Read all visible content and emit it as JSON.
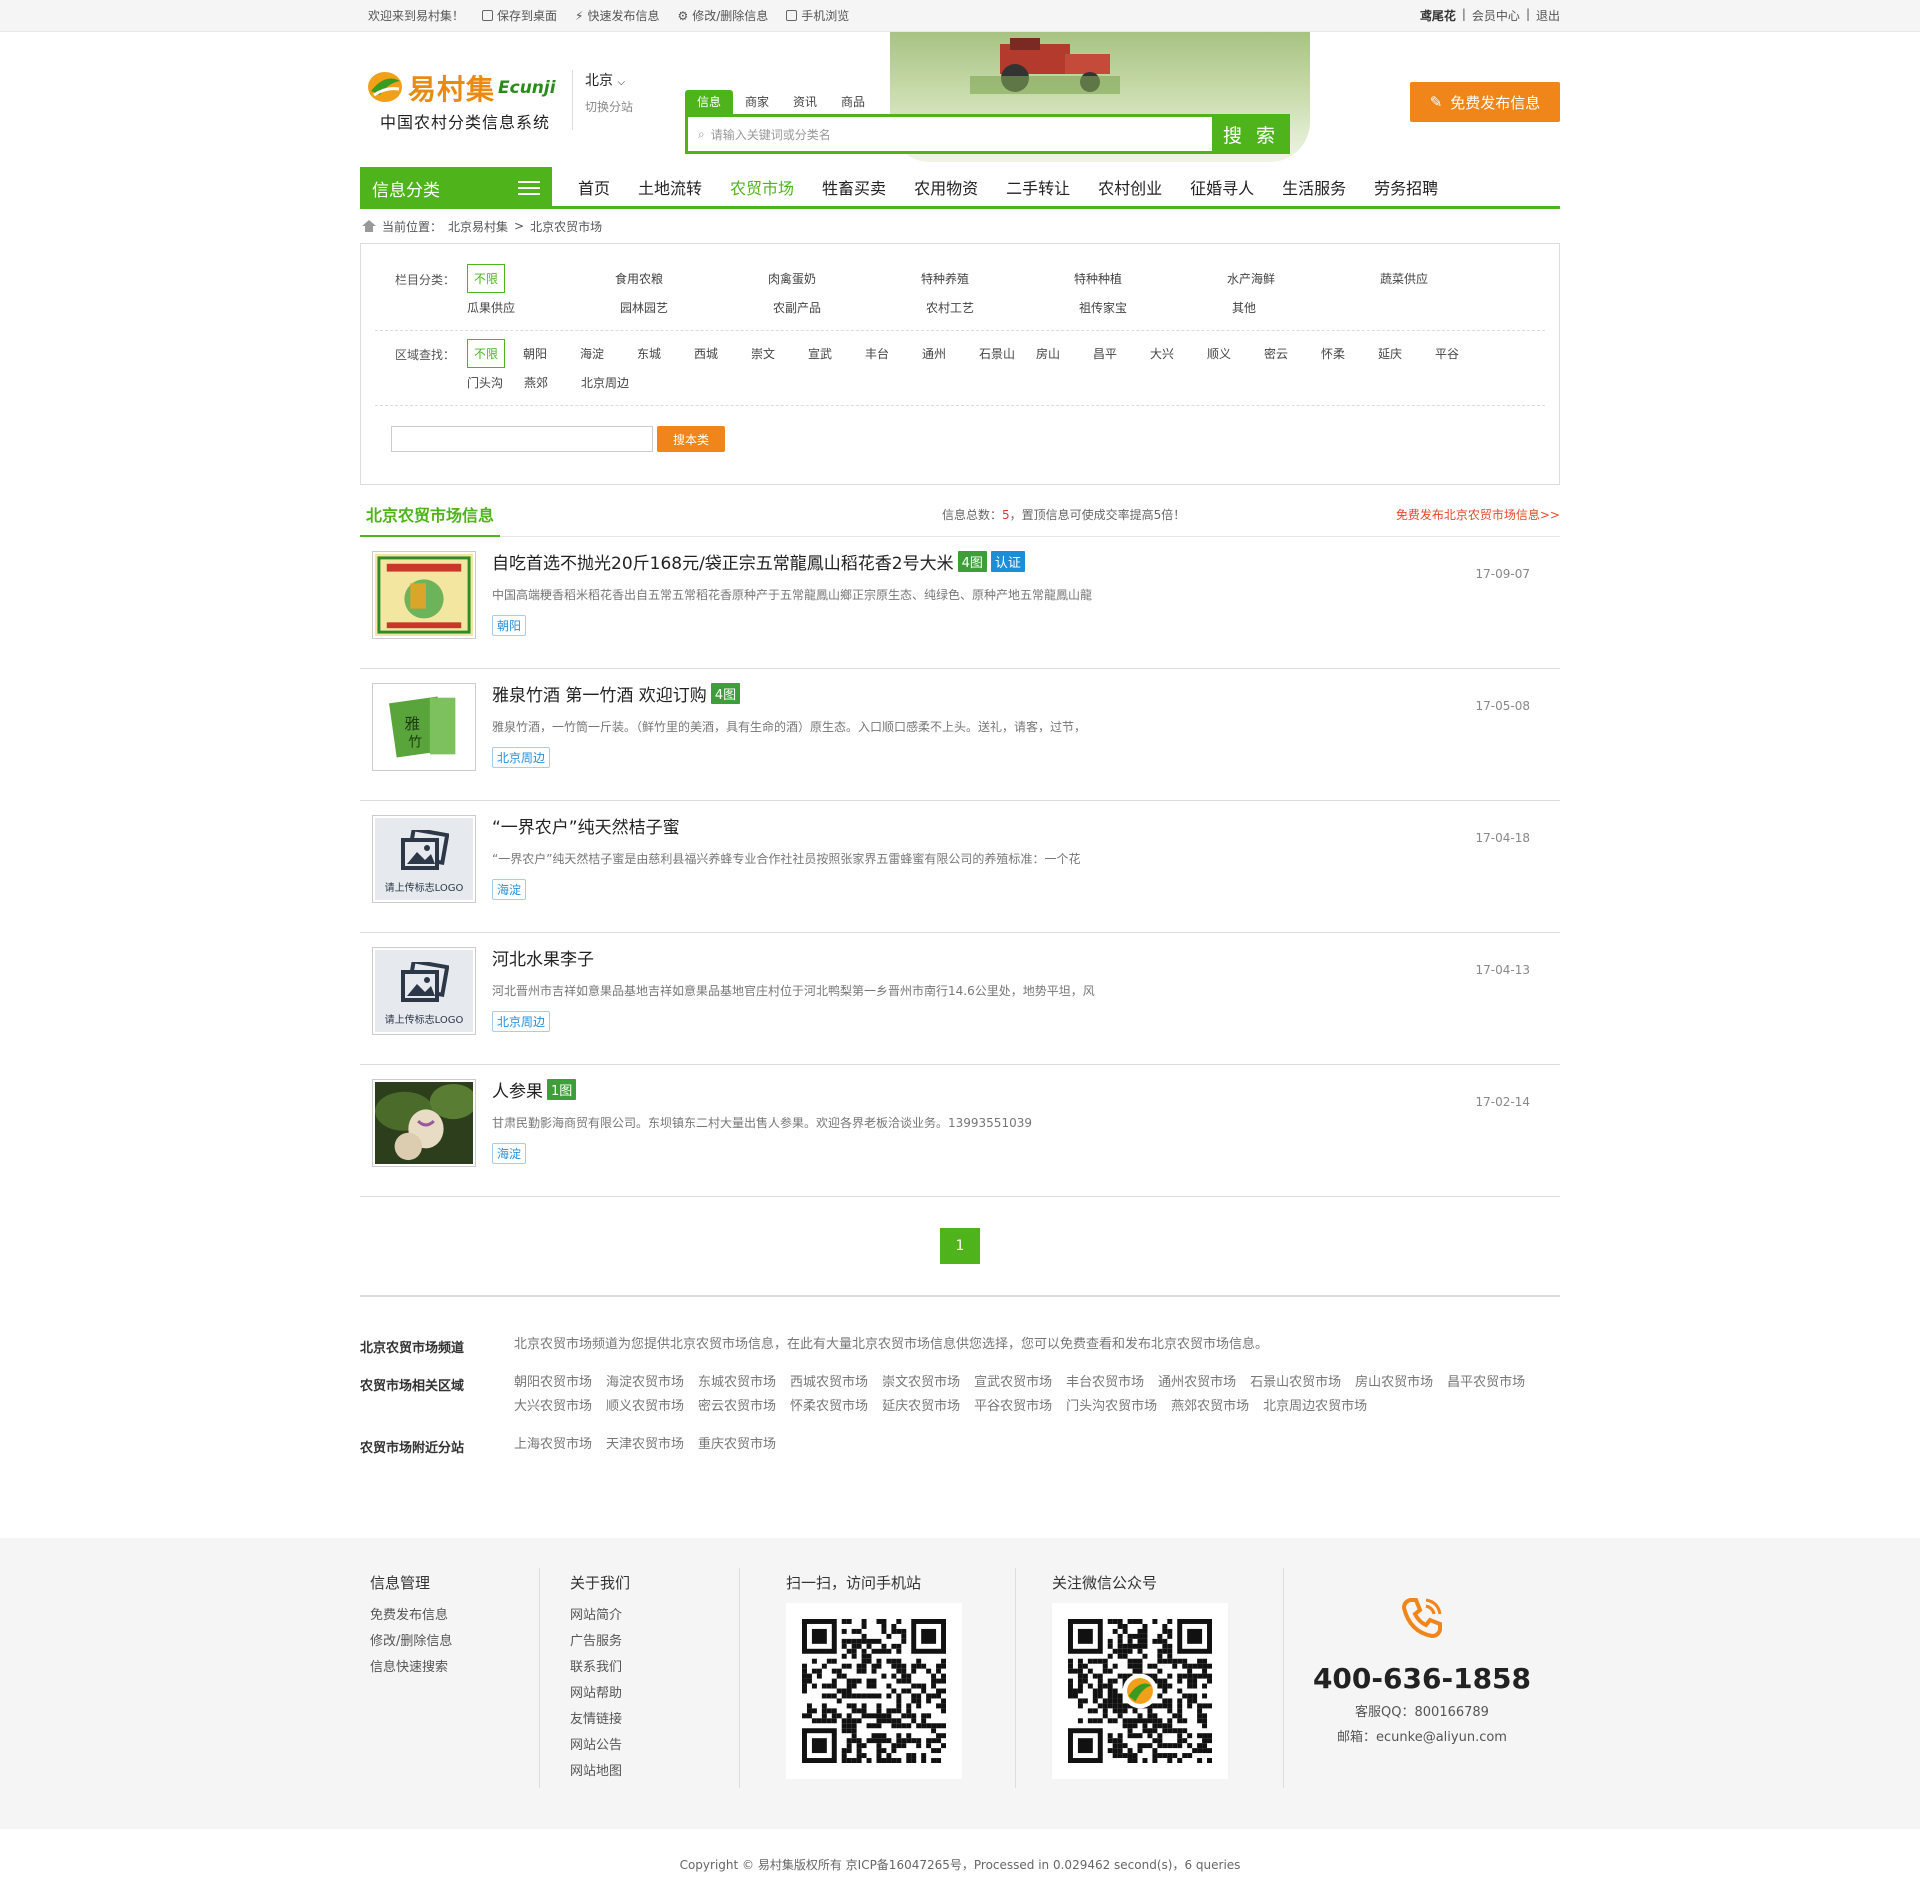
{
  "topbar": {
    "welcome": "欢迎来到易村集！",
    "links": [
      "保存到桌面",
      "快速发布信息",
      "修改/删除信息",
      "手机浏览"
    ],
    "user": "鸢尾花",
    "member": "会员中心",
    "logout": "退出"
  },
  "header": {
    "logo_cn": "易村集",
    "logo_en": "Ecunji",
    "slogan": "中国农村分类信息系统",
    "city": "北京",
    "switch": "切换分站",
    "search_tabs": [
      "信息",
      "商家",
      "资讯",
      "商品"
    ],
    "search_placeholder": "请输入关键词或分类名",
    "search_button": "搜 索",
    "publish_button": "免费发布信息"
  },
  "nav": {
    "category": "信息分类",
    "items": [
      "首页",
      "土地流转",
      "农贸市场",
      "牲畜买卖",
      "农用物资",
      "二手转让",
      "农村创业",
      "征婚寻人",
      "生活服务",
      "劳务招聘"
    ],
    "active": "农贸市场"
  },
  "breadcrumb": {
    "prefix": "当前位置：",
    "path": [
      "北京易村集",
      "北京农贸市场"
    ],
    "sep": ">"
  },
  "filter": {
    "cat_label": "栏目分类：",
    "cat_options": [
      "不限",
      "食用农粮",
      "肉禽蛋奶",
      "特种养殖",
      "特种种植",
      "水产海鲜",
      "蔬菜供应",
      "瓜果供应",
      "园林园艺",
      "农副产品",
      "农村工艺",
      "祖传家宝",
      "其他"
    ],
    "area_label": "区域查找：",
    "area_options": [
      "不限",
      "朝阳",
      "海淀",
      "东城",
      "西城",
      "崇文",
      "宣武",
      "丰台",
      "通州",
      "石景山",
      "房山",
      "昌平",
      "大兴",
      "顺义",
      "密云",
      "怀柔",
      "延庆",
      "平谷",
      "门头沟",
      "燕郊",
      "北京周边"
    ],
    "search_button": "搜本类"
  },
  "list": {
    "title": "北京农贸市场信息",
    "count_prefix": "信息总数：",
    "count": "5",
    "count_suffix": "，置顶信息可使成交率提高5倍！",
    "publish_link": "免费发布北京农贸市场信息>>",
    "items": [
      {
        "title": "自吃首选不抛光20斤168元/袋正宗五常龍鳳山稻花香2号大米",
        "badges": [
          "4图",
          "认证"
        ],
        "desc": "中国高端粳香稻米稻花香出自五常五常稻花香原种产于五常龍鳳山鄉正宗原生态、纯绿色、原种产地五常龍鳳山龍",
        "area": "朝阳",
        "date": "17-09-07",
        "thumb": "rice-package-image"
      },
      {
        "title": "雅泉竹酒 第一竹酒 欢迎订购",
        "badges": [
          "4图"
        ],
        "desc": "雅泉竹酒，一竹筒一斤装。（鲜竹里的美酒，具有生命的酒）原生态。入口顺口感柔不上头。送礼，请客，过节，",
        "area": "北京周边",
        "date": "17-05-08",
        "thumb": "bamboo-wine-image"
      },
      {
        "title": "“一界农户”纯天然桔子蜜",
        "badges": [],
        "desc": "“一界农户”纯天然桔子蜜是由慈利县福兴养蜂专业合作社社员按照张家界五雷蜂蜜有限公司的养殖标准：一个花",
        "area": "海淀",
        "date": "17-04-18",
        "thumb": "placeholder",
        "thumb_text": "请上传标志LOGO"
      },
      {
        "title": "河北水果李子",
        "badges": [],
        "desc": "河北晋州市吉祥如意果品基地吉祥如意果品基地官庄村位于河北鸭梨第一乡晋州市南行14.6公里处，地势平坦，风",
        "area": "北京周边",
        "date": "17-04-13",
        "thumb": "placeholder",
        "thumb_text": "请上传标志LOGO"
      },
      {
        "title": "人参果",
        "badges": [
          "1图"
        ],
        "desc": "甘肃民勤影海商贸有限公司。东坝镇东二村大量出售人参果。欢迎各界老板洽谈业务。13993551039",
        "area": "海淀",
        "date": "17-02-14",
        "thumb": "ginseng-fruit-image"
      }
    ]
  },
  "pager": {
    "current": "1"
  },
  "seo": {
    "channel_label": "北京农贸市场频道",
    "channel_text": "北京农贸市场频道为您提供北京农贸市场信息，在此有大量北京农贸市场信息供您选择，您可以免费查看和发布北京农贸市场信息。",
    "areas_label": "农贸市场相关区域",
    "areas": [
      "朝阳农贸市场",
      "海淀农贸市场",
      "东城农贸市场",
      "西城农贸市场",
      "崇文农贸市场",
      "宣武农贸市场",
      "丰台农贸市场",
      "通州农贸市场",
      "石景山农贸市场",
      "房山农贸市场",
      "昌平农贸市场",
      "大兴农贸市场",
      "顺义农贸市场",
      "密云农贸市场",
      "怀柔农贸市场",
      "延庆农贸市场",
      "平谷农贸市场",
      "门头沟农贸市场",
      "燕郊农贸市场",
      "北京周边农贸市场"
    ],
    "near_label": "农贸市场附近分站",
    "near": [
      "上海农贸市场",
      "天津农贸市场",
      "重庆农贸市场"
    ]
  },
  "footer": {
    "col1_title": "信息管理",
    "col1_links": [
      "免费发布信息",
      "修改/删除信息",
      "信息快速搜索"
    ],
    "col2_title": "关于我们",
    "col2_links": [
      "网站简介",
      "广告服务",
      "联系我们",
      "网站帮助",
      "友情链接",
      "网站公告",
      "网站地图"
    ],
    "col3_title": "扫一扫，访问手机站",
    "col4_title": "关注微信公众号",
    "tel": "400-636-1858",
    "qq": "客服QQ：800166789",
    "mail": "邮箱：ecunke@aliyun.com"
  },
  "copyright": "Copyright © 易村集版权所有 京ICP备16047265号，Processed in 0.029462 second(s)，6 queries",
  "colors": {
    "green": "#4fb41b",
    "orange": "#f08519",
    "red": "#e34a2b"
  }
}
